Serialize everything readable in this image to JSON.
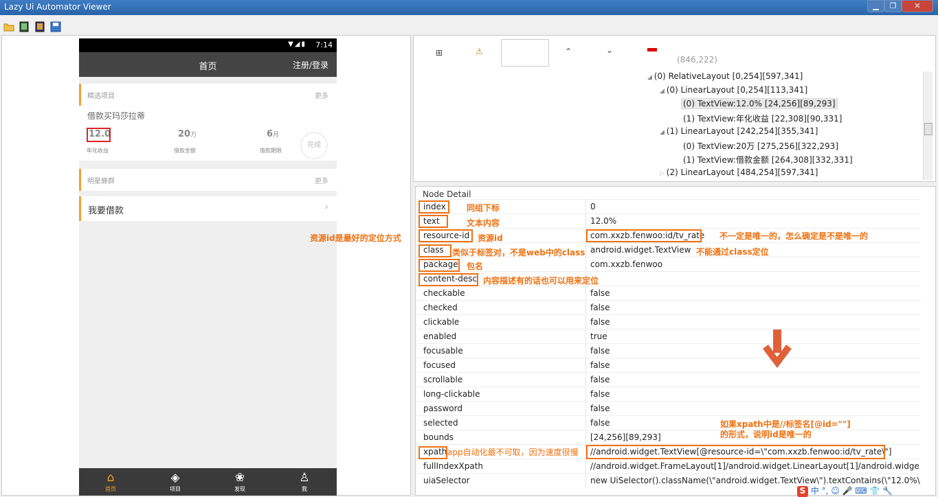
{
  "window": {
    "title": "Lazy Ui Automator Viewer"
  },
  "toolbar": {
    "icons": [
      "folder-open-icon",
      "device-screenshot-icon",
      "device-screenshot-compressed-icon",
      "save-icon"
    ]
  },
  "phone": {
    "status_time": "7:14",
    "header_title": "首页",
    "header_login": "注册/登录",
    "section1_title": "精选项目",
    "section1_more": "更多",
    "card_name": "借款买玛莎拉蒂",
    "rate_value": "12.0",
    "rate_label": "年化收益",
    "amount_value": "20",
    "amount_unit": "万",
    "amount_label": "借款金额",
    "period_value": "6",
    "period_unit": "月",
    "period_label": "借款期限",
    "status_badge": "完成",
    "section2_title": "明星蜂群",
    "section2_more": "更多",
    "loan_row": "我要借款",
    "nav": [
      {
        "label": "首页",
        "icon": "home-icon"
      },
      {
        "label": "项目",
        "icon": "layers-icon"
      },
      {
        "label": "发现",
        "icon": "discover-icon"
      },
      {
        "label": "我",
        "icon": "user-icon"
      }
    ]
  },
  "left_annotation": "资源id是最好的定位方式",
  "tree_toolbar": {
    "coords": "(846,222)"
  },
  "tree": [
    "(0) RelativeLayout [0,254][597,341]",
    "(0) LinearLayout [0,254][113,341]",
    "(0) TextView:12.0% [24,256][89,293]",
    "(1) TextView:年化收益 [22,308][90,331]",
    "(1) LinearLayout [242,254][355,341]",
    "(0) TextView:20万 [275,256][322,293]",
    "(1) TextView:借款金额 [264,308][332,331]",
    "(2) LinearLayout [484,254][597,341]"
  ],
  "detail": {
    "header": "Node Detail",
    "rows": [
      {
        "k": "index",
        "v": "0"
      },
      {
        "k": "text",
        "v": "12.0%"
      },
      {
        "k": "resource-id",
        "v": "com.xxzb.fenwoo:id/tv_rate"
      },
      {
        "k": "class",
        "v": "android.widget.TextView"
      },
      {
        "k": "package",
        "v": "com.xxzb.fenwoo"
      },
      {
        "k": "content-desc",
        "v": ""
      },
      {
        "k": "checkable",
        "v": "false"
      },
      {
        "k": "checked",
        "v": "false"
      },
      {
        "k": "clickable",
        "v": "false"
      },
      {
        "k": "enabled",
        "v": "true"
      },
      {
        "k": "focusable",
        "v": "false"
      },
      {
        "k": "focused",
        "v": "false"
      },
      {
        "k": "scrollable",
        "v": "false"
      },
      {
        "k": "long-clickable",
        "v": "false"
      },
      {
        "k": "password",
        "v": "false"
      },
      {
        "k": "selected",
        "v": "false"
      },
      {
        "k": "bounds",
        "v": "[24,256][89,293]"
      },
      {
        "k": "xpath",
        "v": "//android.widget.TextView[@resource-id=\\\"com.xxzb.fenwoo:id/tv_rate\\\"]"
      },
      {
        "k": "fullIndexXpath",
        "v": "//android.widget.FrameLayout[1]/android.widget.LinearLayout[1]/android.widge..."
      },
      {
        "k": "uiaSelector",
        "v": "new UiSelector().className(\\\"android.widget.TextView\\\").textContains(\\\"12.0%\\\"..."
      }
    ]
  },
  "annotations": {
    "index": "同组下标",
    "text": "文本内容",
    "resource_id": "资源id",
    "resource_id_note": "不一定是唯一的，怎么确定是不是唯一的",
    "class": "类似于标签对，不是web中的class",
    "class_note": "不能通过class定位",
    "package": "包名",
    "content_desc": "内容描述有的话也可以用来定位",
    "xpath": "app自动化最不可取，因为速度很慢",
    "xpath_note_1": "如果xpath中是//标签名[@id=\"\"]",
    "xpath_note_2": "的形式，说明id是唯一的"
  },
  "ime": {
    "text": "中 °, ☺ 🎤 ⌨ 👕 🔧"
  }
}
